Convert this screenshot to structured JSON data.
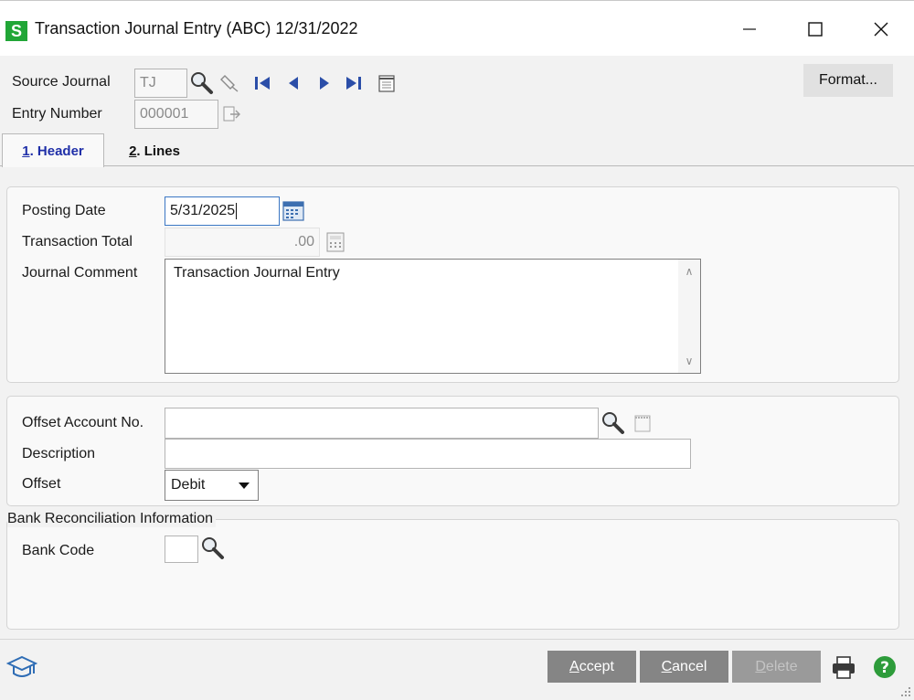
{
  "window": {
    "app_logo_letter": "S",
    "title": "Transaction Journal Entry (ABC) 12/31/2022",
    "controls": {
      "minimize": "minimize-icon",
      "maximize": "maximize-icon",
      "close": "close-icon"
    }
  },
  "toolbar": {
    "source_journal_label": "Source Journal",
    "source_journal_value": "TJ",
    "entry_number_label": "Entry Number",
    "entry_number_value": "000001",
    "format_label": "Format..."
  },
  "tabs": [
    {
      "number": "1",
      "label": ". Header",
      "active": true
    },
    {
      "number": "2",
      "label": ". Lines",
      "active": false
    }
  ],
  "header": {
    "posting_date_label": "Posting Date",
    "posting_date_value": "5/31/2025",
    "transaction_total_label": "Transaction Total",
    "transaction_total_value": ".00",
    "journal_comment_label": "Journal Comment",
    "journal_comment_value": "Transaction Journal Entry"
  },
  "offset": {
    "account_label": "Offset Account No.",
    "account_value": "",
    "description_label": "Description",
    "description_value": "",
    "offset_label": "Offset",
    "offset_selected": "Debit"
  },
  "bank": {
    "legend": "Bank Reconciliation Information",
    "bank_code_label": "Bank Code",
    "bank_code_value": ""
  },
  "actions": {
    "accept_first": "A",
    "accept_rest": "ccept",
    "cancel_first": "C",
    "cancel_rest": "ancel",
    "delete_first": "D",
    "delete_rest": "elete"
  },
  "colors": {
    "accent_logo": "#21a637",
    "active_tab_text": "#1f2fa8",
    "button_bg": "#858585",
    "help_icon": "#2e9c3b"
  }
}
